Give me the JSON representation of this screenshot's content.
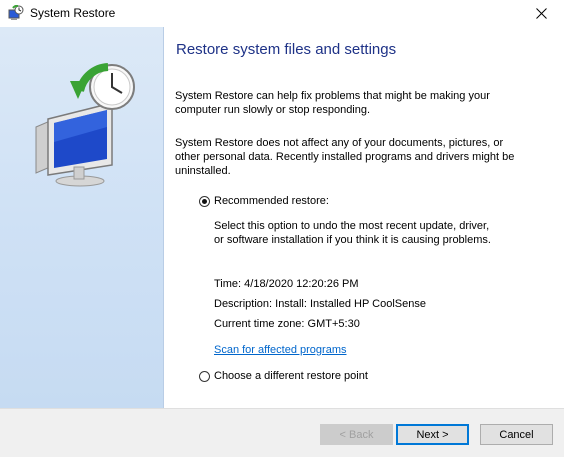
{
  "window": {
    "title": "System Restore",
    "app_icon": "system-restore-icon",
    "close_icon": "close-icon"
  },
  "content": {
    "heading": "Restore system files and settings",
    "paragraph1_line1": "System Restore can help fix problems that might be making your",
    "paragraph1_line2": "computer run slowly or stop responding.",
    "paragraph2_line1": "System Restore does not affect any of your documents, pictures, or",
    "paragraph2_line2": "other personal data. Recently installed programs and drivers might be",
    "paragraph2_line3": "uninstalled."
  },
  "options": {
    "recommended": {
      "label": "Recommended restore:",
      "selected": true,
      "desc_line1": "Select this option to undo the most recent update, driver,",
      "desc_line2": "or software installation if you think it is causing problems."
    },
    "different": {
      "label": "Choose a different restore point",
      "selected": false
    }
  },
  "details": {
    "time": "Time: 4/18/2020 12:20:26 PM",
    "description": "Description: Install: Installed HP CoolSense",
    "timezone": "Current time zone: GMT+5:30"
  },
  "links": {
    "scan": "Scan for affected programs"
  },
  "buttons": {
    "back": "< Back",
    "next": "Next >",
    "cancel": "Cancel"
  },
  "colors": {
    "heading": "#1e3287",
    "link": "#0066cc",
    "sidebar": "#cfe1f5",
    "accent": "#0078d7"
  }
}
